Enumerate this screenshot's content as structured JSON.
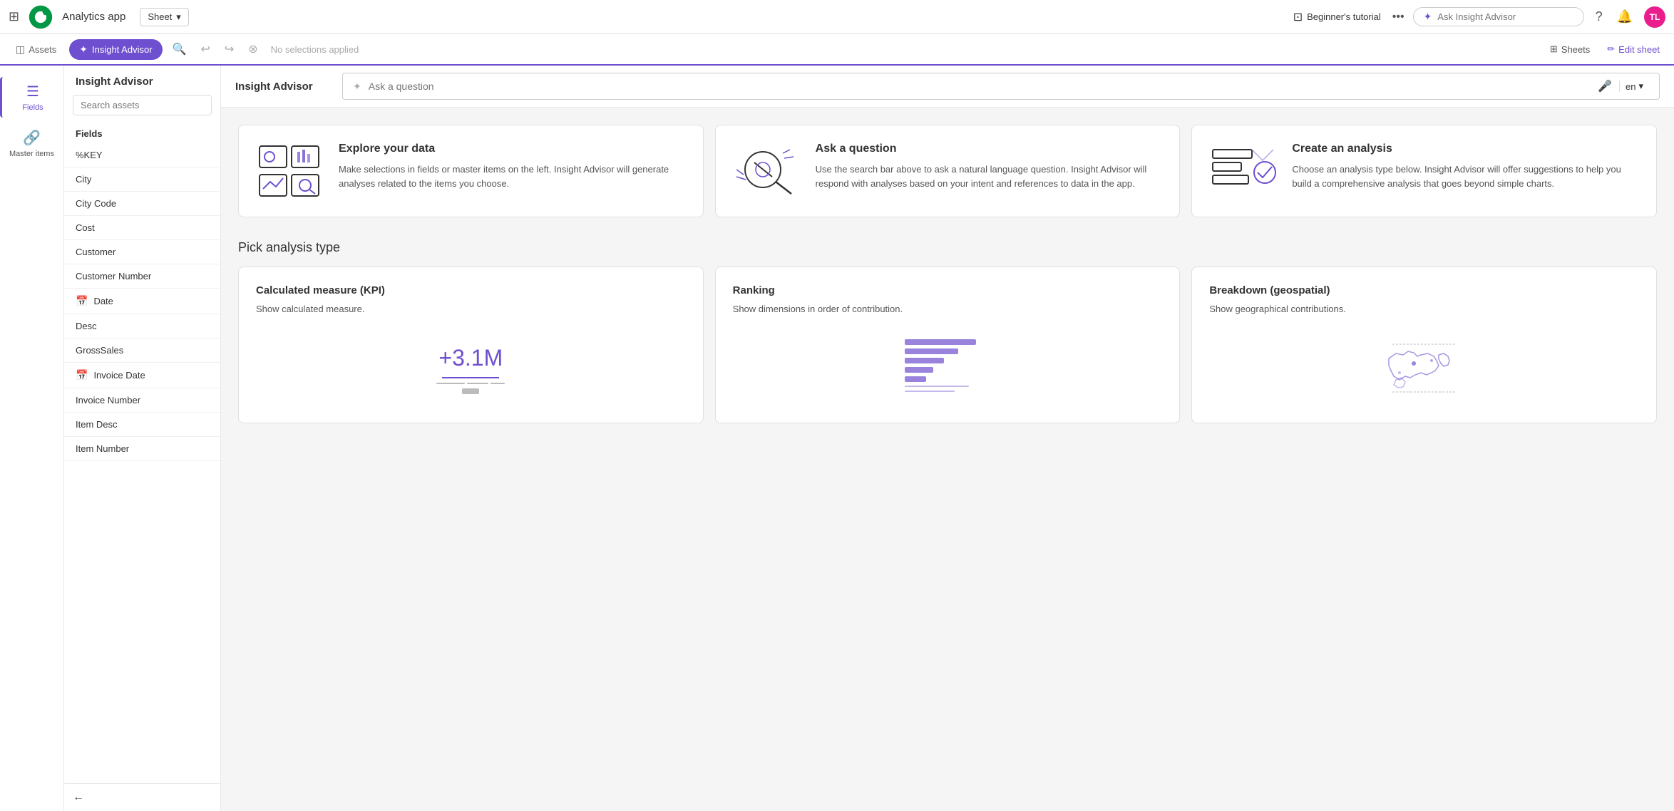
{
  "topNav": {
    "appTitle": "Analytics app",
    "sheetLabel": "Sheet",
    "tutorialLabel": "Beginner's tutorial",
    "askInsightPlaceholder": "Ask Insight Advisor",
    "avatarInitials": "TL"
  },
  "subToolbar": {
    "assetsLabel": "Assets",
    "insightAdvisorLabel": "Insight Advisor",
    "noSelectionsLabel": "No selections applied",
    "sheetsLabel": "Sheets",
    "editSheetLabel": "Edit sheet"
  },
  "sidebar": {
    "title": "Insight Advisor",
    "searchPlaceholder": "Search assets",
    "fieldsLabel": "Fields",
    "fields": [
      {
        "name": "%KEY",
        "icon": ""
      },
      {
        "name": "City",
        "icon": ""
      },
      {
        "name": "City Code",
        "icon": ""
      },
      {
        "name": "Cost",
        "icon": ""
      },
      {
        "name": "Customer",
        "icon": ""
      },
      {
        "name": "Customer Number",
        "icon": ""
      },
      {
        "name": "Date",
        "icon": "calendar"
      },
      {
        "name": "Desc",
        "icon": ""
      },
      {
        "name": "GrossSales",
        "icon": ""
      },
      {
        "name": "Invoice Date",
        "icon": "calendar"
      },
      {
        "name": "Invoice Number",
        "icon": ""
      },
      {
        "name": "Item Desc",
        "icon": ""
      },
      {
        "name": "Item Number",
        "icon": ""
      }
    ],
    "leftPanel": [
      {
        "label": "Fields",
        "icon": "fields",
        "active": true
      },
      {
        "label": "Master items",
        "icon": "link",
        "active": false
      }
    ]
  },
  "insightHeader": {
    "title": "Insight Advisor",
    "askPlaceholder": "Ask a question",
    "langLabel": "en"
  },
  "introCards": [
    {
      "title": "Explore your data",
      "description": "Make selections in fields or master items on the left. Insight Advisor will generate analyses related to the items you choose."
    },
    {
      "title": "Ask a question",
      "description": "Use the search bar above to ask a natural language question. Insight Advisor will respond with analyses based on your intent and references to data in the app."
    },
    {
      "title": "Create an analysis",
      "description": "Choose an analysis type below. Insight Advisor will offer suggestions to help you build a comprehensive analysis that goes beyond simple charts."
    }
  ],
  "analysisSection": {
    "title": "Pick analysis type",
    "cards": [
      {
        "title": "Calculated measure (KPI)",
        "description": "Show calculated measure.",
        "kpiValue": "+3.1M"
      },
      {
        "title": "Ranking",
        "description": "Show dimensions in order of contribution."
      },
      {
        "title": "Breakdown (geospatial)",
        "description": "Show geographical contributions."
      }
    ]
  }
}
